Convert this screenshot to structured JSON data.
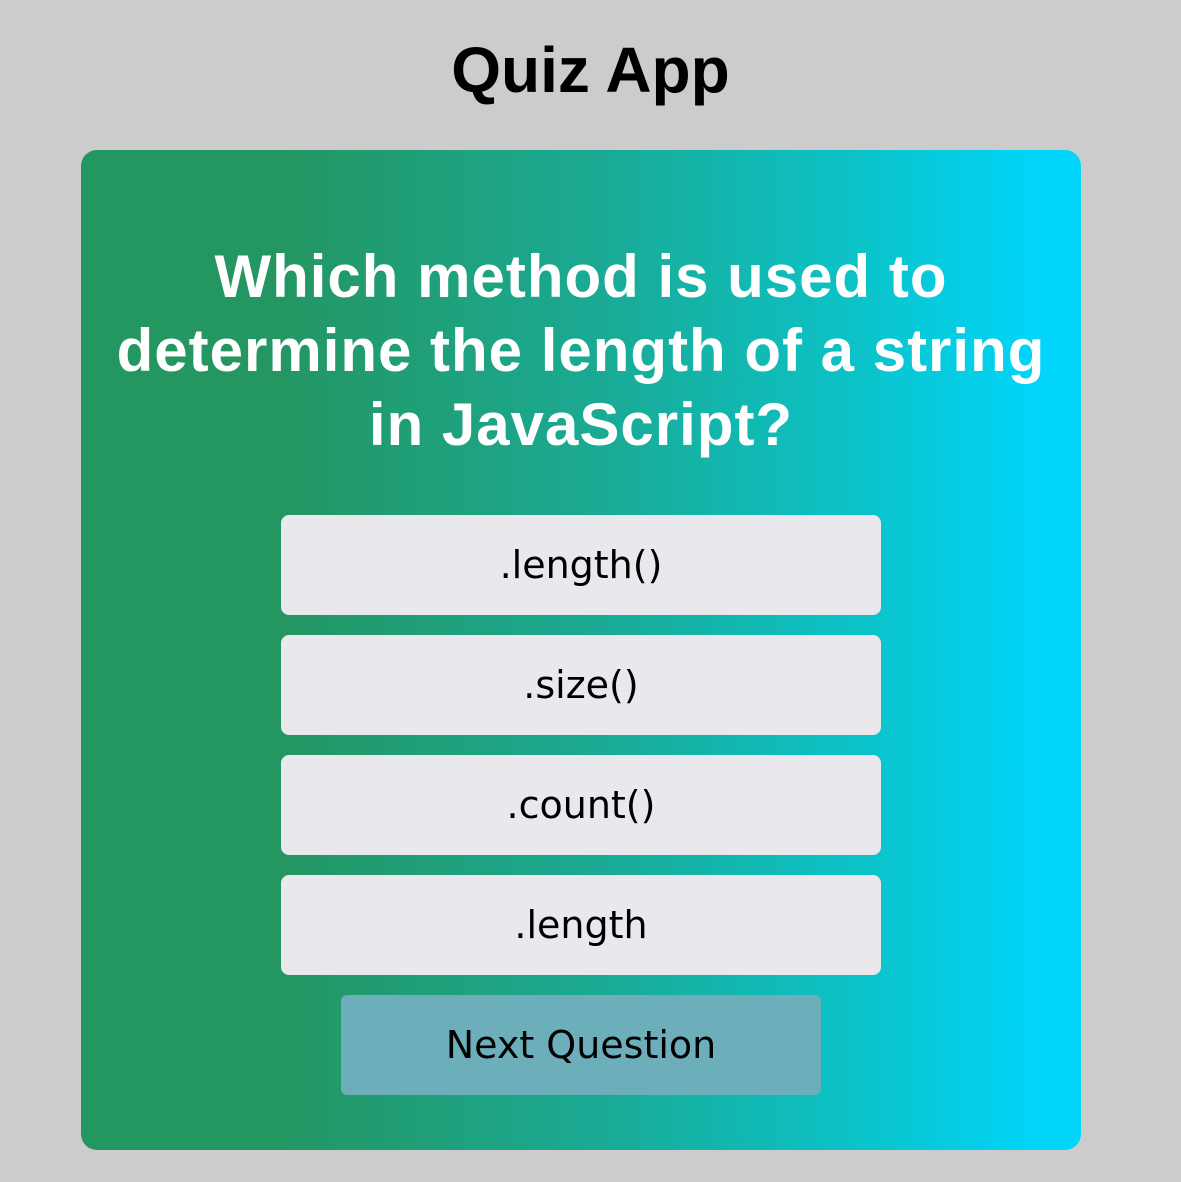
{
  "app": {
    "title": "Quiz App"
  },
  "quiz": {
    "question": "Which method is used to determine the length of a string in JavaScript?",
    "answers": [
      ".length()",
      ".size()",
      ".count()",
      ".length"
    ],
    "next_label": "Next Question"
  },
  "colors": {
    "page_background": "#cccccc",
    "card_gradient_start": "#249662",
    "card_gradient_end": "#01d5fb",
    "answer_button": "#e9e8ed",
    "next_button": "#6cafbb"
  }
}
